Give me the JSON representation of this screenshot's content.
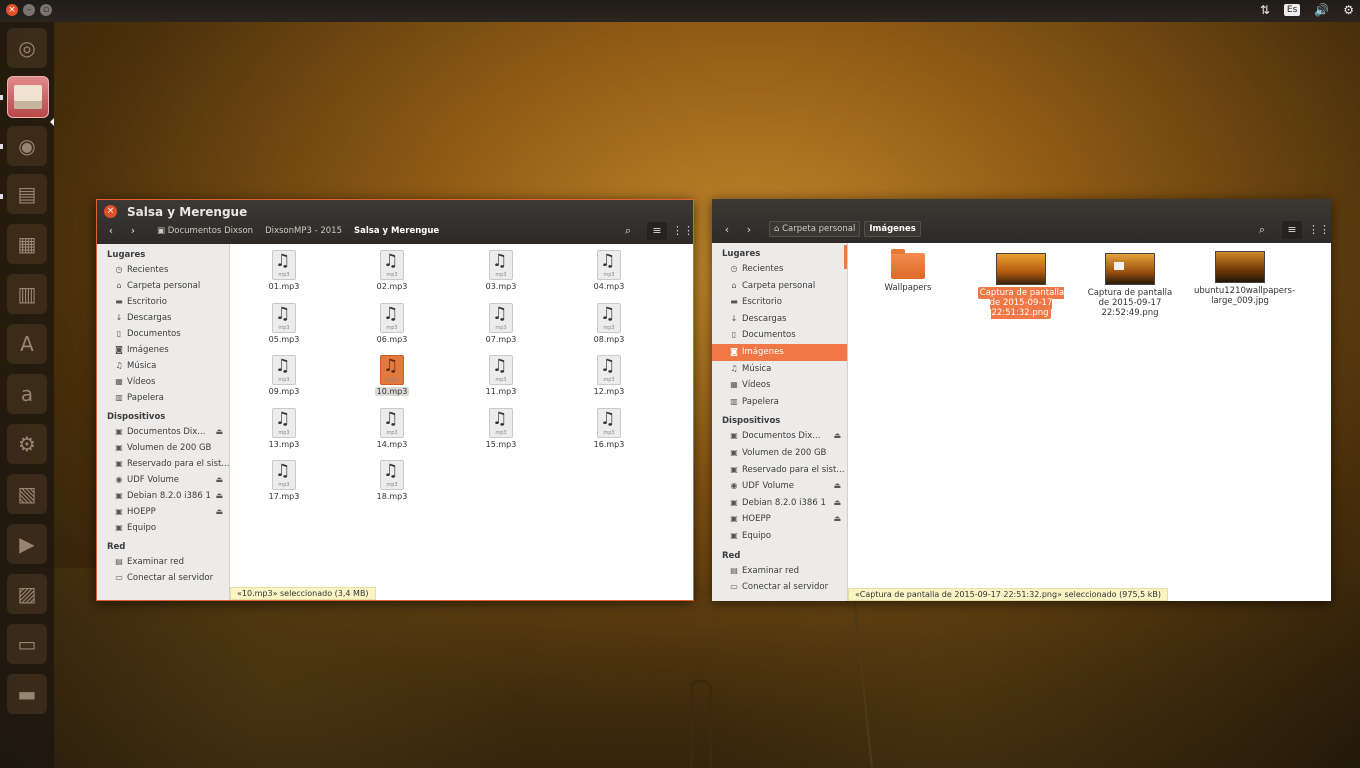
{
  "panel": {
    "keyboard": "Es",
    "network_icon": "network-arrows-icon",
    "volume_icon": "volume-icon",
    "settings_icon": "gear-icon"
  },
  "launcher": {
    "items": [
      "ubuntu-dash",
      "files",
      "chromium",
      "libreoffice-writer",
      "libreoffice-calc",
      "libreoffice-impress",
      "software-center",
      "amazon",
      "system-settings",
      "app",
      "video",
      "app2",
      "drive",
      "trash"
    ],
    "amazon_glyph": "a",
    "software_glyph": "A"
  },
  "w1": {
    "title": "Salsa y Merengue",
    "crumbs": [
      "Documentos Dixson",
      "DixsonMP3 - 2015",
      "Salsa y Merengue"
    ],
    "places_header": "Lugares",
    "places": [
      "Recientes",
      "Carpeta personal",
      "Escritorio",
      "Descargas",
      "Documentos",
      "Imágenes",
      "Música",
      "Vídeos",
      "Papelera"
    ],
    "devices_header": "Dispositivos",
    "devices": [
      "Documentos Dix...",
      "Volumen de 200 GB",
      "Reservado para el sist...",
      "UDF Volume",
      "Debian 8.2.0 i386 1",
      "HOEPP",
      "Equipo"
    ],
    "network_header": "Red",
    "network": [
      "Examinar red",
      "Conectar al servidor"
    ],
    "files": [
      "01.mp3",
      "02.mp3",
      "03.mp3",
      "04.mp3",
      "05.mp3",
      "06.mp3",
      "07.mp3",
      "08.mp3",
      "09.mp3",
      "10.mp3",
      "11.mp3",
      "12.mp3",
      "13.mp3",
      "14.mp3",
      "15.mp3",
      "16.mp3",
      "17.mp3",
      "18.mp3"
    ],
    "file_ext_label": "mp3",
    "selected_file": "10.mp3",
    "status": "«10.mp3» seleccionado  (3,4 MB)"
  },
  "w2": {
    "crumbs": [
      "Carpeta personal",
      "Imágenes"
    ],
    "places_header": "Lugares",
    "places": [
      "Recientes",
      "Carpeta personal",
      "Escritorio",
      "Descargas",
      "Documentos",
      "Imágenes",
      "Música",
      "Vídeos",
      "Papelera"
    ],
    "selected_place": "Imágenes",
    "devices_header": "Dispositivos",
    "devices": [
      "Documentos Dix...",
      "Volumen de 200 GB",
      "Reservado para el sist...",
      "UDF Volume",
      "Debian 8.2.0 i386 1",
      "HOEPP",
      "Equipo"
    ],
    "network_header": "Red",
    "network": [
      "Examinar red",
      "Conectar al servidor"
    ],
    "items": [
      {
        "name": "Wallpapers",
        "kind": "folder"
      },
      {
        "name": "Captura de pantalla de 2015-09-17 22:51:32.png",
        "kind": "image",
        "selected": true
      },
      {
        "name": "Captura de pantalla de 2015-09-17 22:52:49.png",
        "kind": "image"
      },
      {
        "name": "ubuntu1210wallpapers-large_009.jpg",
        "kind": "image"
      }
    ],
    "status": "«Captura de pantalla de 2015-09-17 22:51:32.png» seleccionado  (975,5 kB)"
  },
  "colors": {
    "accent": "#f07746",
    "close": "#e0502c",
    "titlebar": "#3c3834",
    "status_bg": "#fbf5c6"
  }
}
